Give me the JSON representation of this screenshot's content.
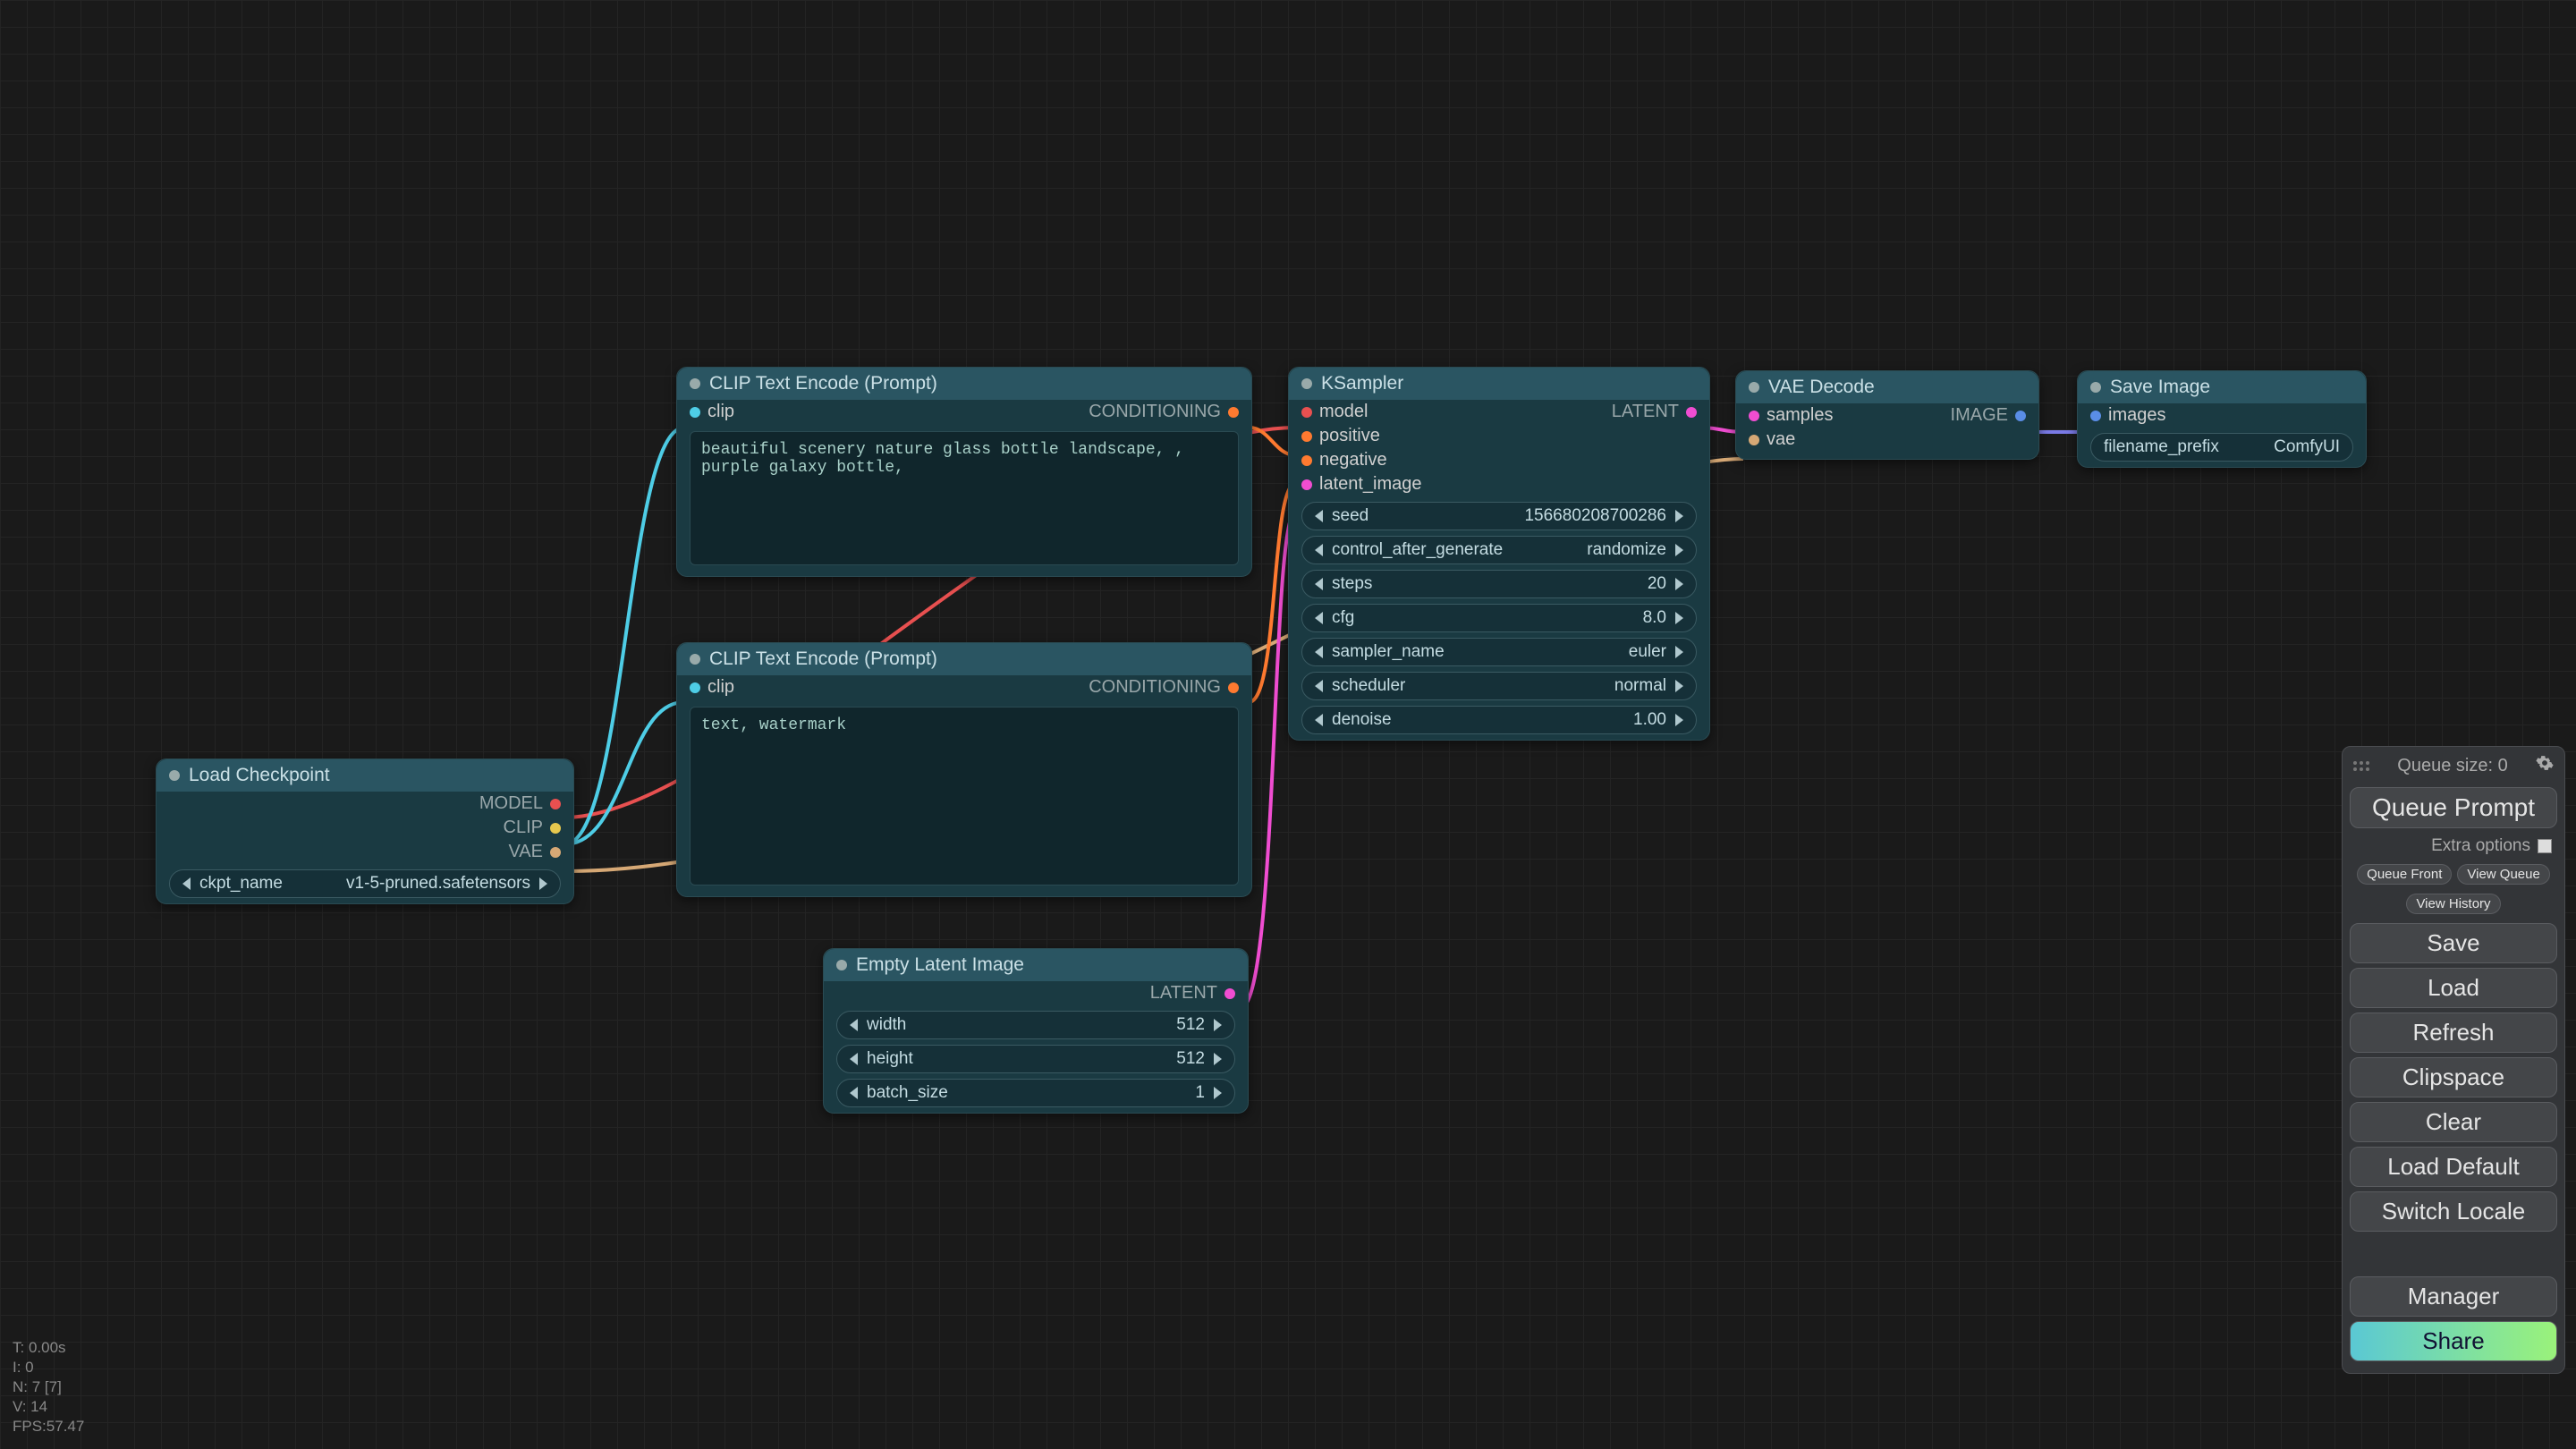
{
  "stats": {
    "t": "T: 0.00s",
    "i": "I: 0",
    "n": "N: 7 [7]",
    "v": "V: 14",
    "fps": "FPS:57.47"
  },
  "side_panel": {
    "queue_size_label": "Queue size: 0",
    "queue_prompt": "Queue Prompt",
    "extra_options": "Extra options",
    "queue_front": "Queue Front",
    "view_queue": "View Queue",
    "view_history": "View History",
    "save": "Save",
    "load": "Load",
    "refresh": "Refresh",
    "clipspace": "Clipspace",
    "clear": "Clear",
    "load_default": "Load Default",
    "switch_locale": "Switch Locale",
    "manager": "Manager",
    "share": "Share"
  },
  "nodes": {
    "load_checkpoint": {
      "title": "Load Checkpoint",
      "outputs": {
        "model": "MODEL",
        "clip": "CLIP",
        "vae": "VAE"
      },
      "ckpt_name_label": "ckpt_name",
      "ckpt_name_value": "v1-5-pruned.safetensors"
    },
    "clip_pos": {
      "title": "CLIP Text Encode (Prompt)",
      "input_clip": "clip",
      "output_cond": "CONDITIONING",
      "text": "beautiful scenery nature glass bottle landscape, , purple galaxy bottle,"
    },
    "clip_neg": {
      "title": "CLIP Text Encode (Prompt)",
      "input_clip": "clip",
      "output_cond": "CONDITIONING",
      "text": "text, watermark"
    },
    "empty_latent": {
      "title": "Empty Latent Image",
      "output_latent": "LATENT",
      "width_label": "width",
      "width_value": "512",
      "height_label": "height",
      "height_value": "512",
      "batch_label": "batch_size",
      "batch_value": "1"
    },
    "ksampler": {
      "title": "KSampler",
      "inputs": {
        "model": "model",
        "positive": "positive",
        "negative": "negative",
        "latent_image": "latent_image"
      },
      "output_latent": "LATENT",
      "seed_label": "seed",
      "seed_value": "156680208700286",
      "control_label": "control_after_generate",
      "control_value": "randomize",
      "steps_label": "steps",
      "steps_value": "20",
      "cfg_label": "cfg",
      "cfg_value": "8.0",
      "sampler_label": "sampler_name",
      "sampler_value": "euler",
      "scheduler_label": "scheduler",
      "scheduler_value": "normal",
      "denoise_label": "denoise",
      "denoise_value": "1.00"
    },
    "vae_decode": {
      "title": "VAE Decode",
      "inputs": {
        "samples": "samples",
        "vae": "vae"
      },
      "output_image": "IMAGE"
    },
    "save_image": {
      "title": "Save Image",
      "input_images": "images",
      "prefix_label": "filename_prefix",
      "prefix_value": "ComfyUI"
    }
  }
}
